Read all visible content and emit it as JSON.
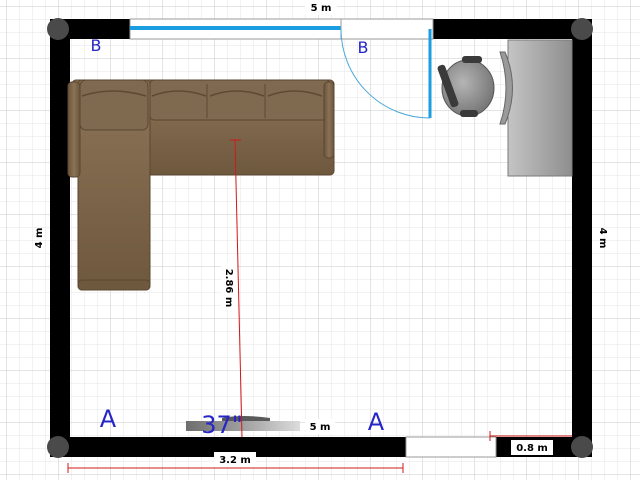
{
  "room": {
    "top_wall_label": "5 m",
    "bottom_wall_label": "5 m",
    "left_wall_label": "4 m",
    "right_wall_label": "4 m"
  },
  "measurements": {
    "couch_to_tv": "2.86 m",
    "bottom_span": "3.2 m",
    "door_width": "0.8 m",
    "tv_size": "37\""
  },
  "markers": {
    "a_left": "A",
    "a_right": "A",
    "b_left": "B",
    "b_right": "B"
  },
  "colors": {
    "wall": "#000000",
    "window": "#1a9ee0",
    "measure_line": "#d01818",
    "sofa": "#7b6448",
    "desk": "#a9a9a9",
    "marker_text": "#2626c8",
    "grid_minor": "#e6e6e6",
    "grid_major": "#c8c8c8"
  }
}
